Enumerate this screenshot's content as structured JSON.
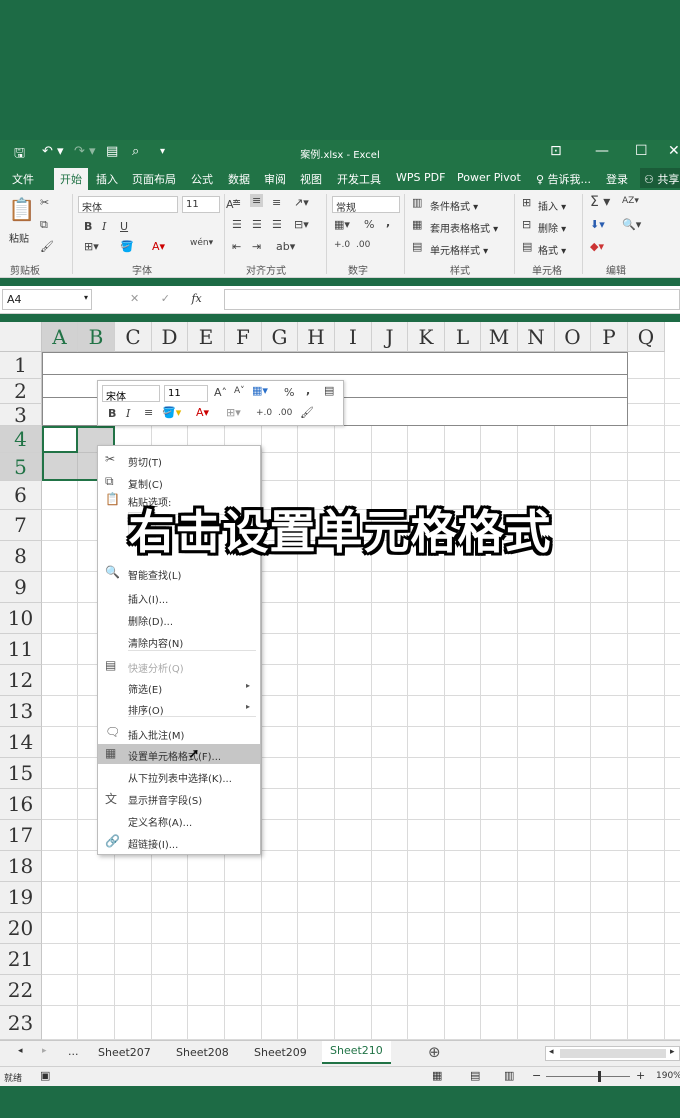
{
  "title_bar": {
    "title": "案例.xlsx - Excel",
    "save_glyph": "🖫",
    "undo_glyph": "↶ ▾",
    "redo_glyph": "↷ ▾",
    "more_glyph": "▾",
    "ribbon_display_glyph": "⊡",
    "minimize_glyph": "—",
    "maximize_glyph": "☐",
    "close_glyph": "✕"
  },
  "menu_tabs": [
    "文件",
    "开始",
    "插入",
    "页面布局",
    "公式",
    "数据",
    "审阅",
    "视图",
    "开发工具",
    "WPS PDF",
    "Power Pivot"
  ],
  "tell_me": "告诉我...",
  "login": "登录",
  "share": "共享",
  "ribbon": {
    "clipboard": {
      "paste": "粘贴",
      "label": "剪贴板"
    },
    "font": {
      "name": "宋体",
      "size": "11",
      "bold": "B",
      "italic": "I",
      "underline": "U",
      "label": "字体"
    },
    "alignment": {
      "label": "对齐方式"
    },
    "number": {
      "format": "常规",
      "percent": "%",
      "comma": ",",
      "label": "数字"
    },
    "styles": {
      "conditional": "条件格式 ▾",
      "table": "套用表格格式 ▾",
      "cell": "单元格样式 ▾",
      "label": "样式"
    },
    "cells": {
      "insert": "插入 ▾",
      "delete": "删除 ▾",
      "format": "格式 ▾",
      "label": "单元格"
    },
    "editing": {
      "sum": "Σ ▾",
      "sort": "AZ▾",
      "label": "编辑"
    }
  },
  "formula_bar": {
    "name_box": "A4",
    "cancel": "✕",
    "enter": "✓",
    "fx": "fx"
  },
  "grid": {
    "columns": [
      "A",
      "B",
      "C",
      "D",
      "E",
      "F",
      "G",
      "H",
      "I",
      "J",
      "K",
      "L",
      "M",
      "N",
      "O",
      "P",
      "Q"
    ],
    "rows": [
      "1",
      "2",
      "3",
      "4",
      "5",
      "6",
      "7",
      "8",
      "9",
      "10",
      "11",
      "12",
      "13",
      "14",
      "15",
      "16",
      "17",
      "18",
      "19",
      "20",
      "21",
      "22",
      "23"
    ],
    "selected_columns": [
      "A",
      "B"
    ],
    "selected_rows": [
      "4",
      "5"
    ]
  },
  "mini_toolbar": {
    "font": "宋体",
    "size": "11",
    "bold": "B",
    "italic": "I",
    "percent": "%",
    "comma": ","
  },
  "context_menu": [
    {
      "label": "剪切(T)",
      "icon": "✂",
      "state": "normal"
    },
    {
      "label": "复制(C)",
      "icon": "⧉",
      "state": "normal"
    },
    {
      "label": "粘贴选项:",
      "icon": "📋",
      "state": "normal"
    },
    {
      "label": "智能查找(L)",
      "icon": "🔍",
      "state": "normal"
    },
    {
      "label": "插入(I)...",
      "icon": "",
      "state": "normal"
    },
    {
      "label": "删除(D)...",
      "icon": "",
      "state": "normal"
    },
    {
      "label": "清除内容(N)",
      "icon": "",
      "state": "normal"
    },
    {
      "label": "快速分析(Q)",
      "icon": "▤",
      "state": "disabled"
    },
    {
      "label": "筛选(E)",
      "icon": "",
      "state": "submenu"
    },
    {
      "label": "排序(O)",
      "icon": "",
      "state": "submenu"
    },
    {
      "label": "插入批注(M)",
      "icon": "🗨",
      "state": "normal"
    },
    {
      "label": "设置单元格格式(F)...",
      "icon": "▦",
      "state": "highlighted"
    },
    {
      "label": "从下拉列表中选择(K)...",
      "icon": "",
      "state": "normal"
    },
    {
      "label": "显示拼音字段(S)",
      "icon": "文",
      "state": "normal"
    },
    {
      "label": "定义名称(A)...",
      "icon": "",
      "state": "normal"
    },
    {
      "label": "超链接(I)...",
      "icon": "🔗",
      "state": "normal"
    }
  ],
  "caption": "右击设置单元格格式",
  "sheet_tabs": {
    "ellipsis": "...",
    "tabs": [
      "Sheet207",
      "Sheet208",
      "Sheet209",
      "Sheet210"
    ],
    "active": "Sheet210",
    "add": "⊕"
  },
  "status_bar": {
    "ready": "就绪",
    "zoom": "190%"
  }
}
